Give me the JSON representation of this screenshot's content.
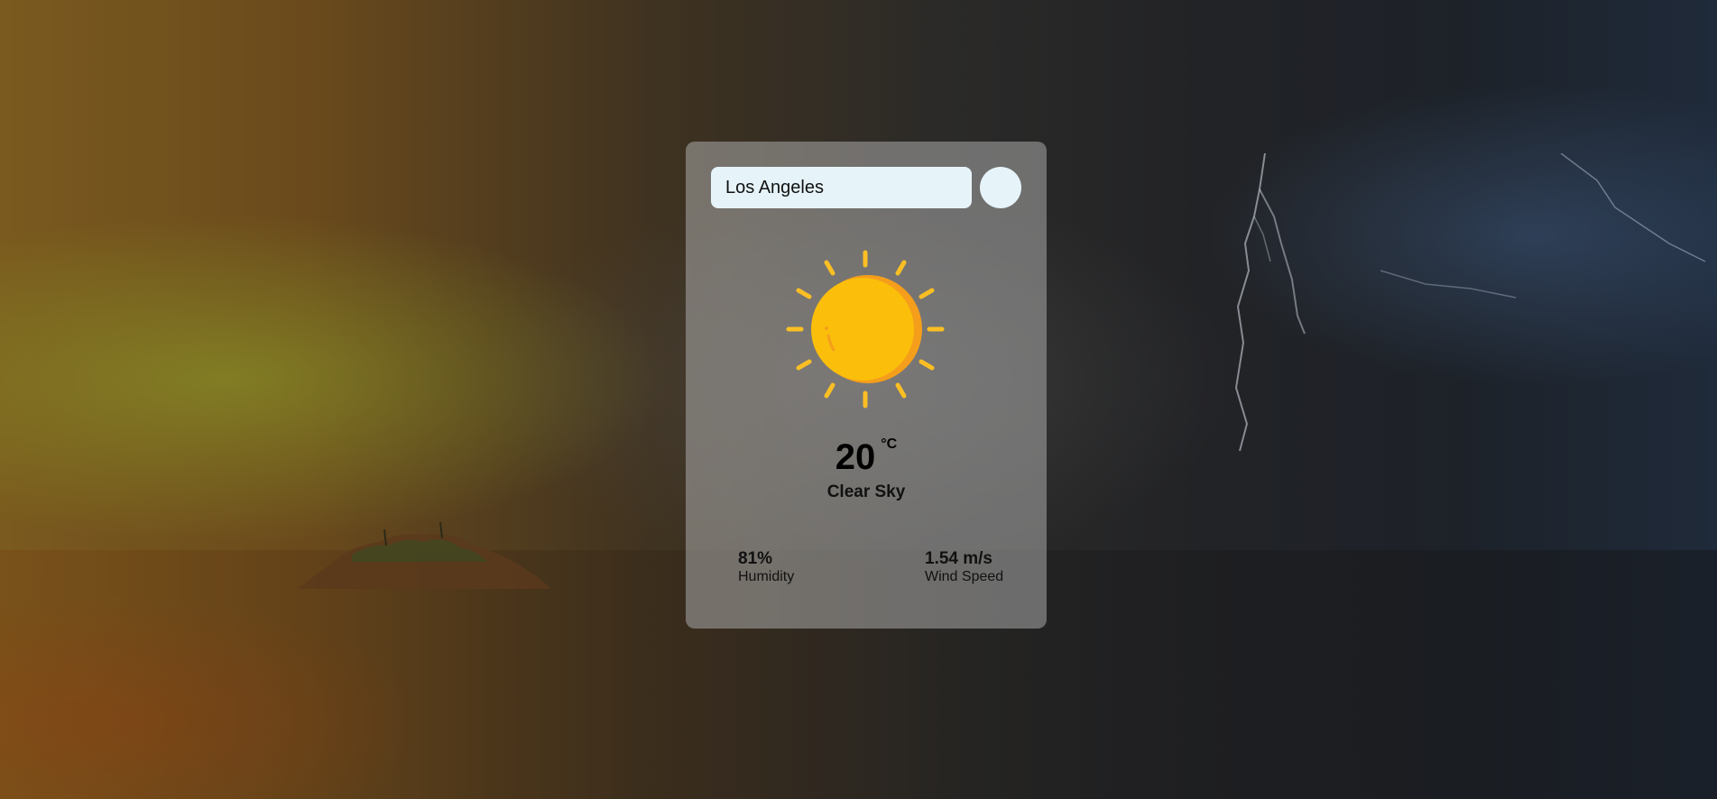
{
  "search": {
    "value": "Los Angeles"
  },
  "weather": {
    "icon": "sun-icon",
    "temperature": "20",
    "unit": "°C",
    "description": "Clear Sky"
  },
  "stats": {
    "humidity": {
      "value": "81%",
      "label": "Humidity"
    },
    "wind": {
      "value": "1.54 m/s",
      "label": "Wind Speed"
    }
  },
  "colors": {
    "input_background": "#e6f4fa",
    "sun_main": "#fbbf0b",
    "sun_shade": "#f59e1b",
    "sun_rays": "#fbbf24"
  }
}
